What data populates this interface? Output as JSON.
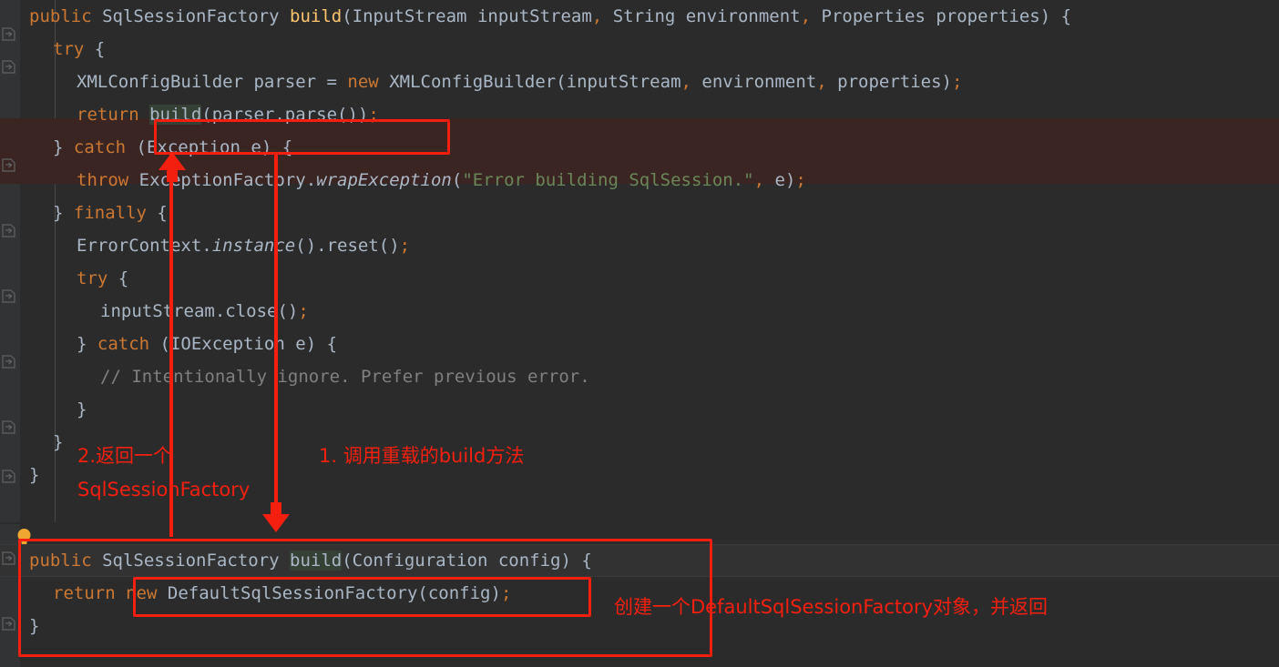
{
  "theme": {
    "background": "#2b2b2b",
    "gutter": "#313335",
    "error_line_background": "#3a2523",
    "current_line_background": "#323232",
    "annotation_color": "#f41f0f",
    "keyword": "#cc7832",
    "method": "#ffc66d",
    "string": "#6a8759",
    "comment": "#808080",
    "text": "#a9b7c6",
    "selection": "#344134"
  },
  "editor_top": {
    "name": "sql-session-factory-builder-build-inputstream",
    "lines": [
      {
        "indent": 0,
        "tokens": [
          {
            "t": "public",
            "c": "kw"
          },
          {
            "t": " ",
            "c": "pun"
          },
          {
            "t": "SqlSessionFactory",
            "c": "typ"
          },
          {
            "t": " ",
            "c": "pun"
          },
          {
            "t": "build",
            "c": "fn"
          },
          {
            "t": "(",
            "c": "pun"
          },
          {
            "t": "InputStream",
            "c": "typ"
          },
          {
            "t": " inputStream",
            "c": "ident"
          },
          {
            "t": ",",
            "c": "semi"
          },
          {
            "t": " ",
            "c": "pun"
          },
          {
            "t": "String",
            "c": "typ"
          },
          {
            "t": " environment",
            "c": "ident"
          },
          {
            "t": ",",
            "c": "semi"
          },
          {
            "t": " ",
            "c": "pun"
          },
          {
            "t": "Properties",
            "c": "typ"
          },
          {
            "t": " properties",
            "c": "ident"
          },
          {
            "t": ") {",
            "c": "pun"
          }
        ]
      },
      {
        "indent": 1,
        "tokens": [
          {
            "t": "try",
            "c": "kw"
          },
          {
            "t": " {",
            "c": "pun"
          }
        ]
      },
      {
        "indent": 2,
        "tokens": [
          {
            "t": "XMLConfigBuilder",
            "c": "typ"
          },
          {
            "t": " parser = ",
            "c": "ident"
          },
          {
            "t": "new",
            "c": "kw"
          },
          {
            "t": " ",
            "c": "pun"
          },
          {
            "t": "XMLConfigBuilder",
            "c": "typ"
          },
          {
            "t": "(inputStream",
            "c": "ident"
          },
          {
            "t": ",",
            "c": "semi"
          },
          {
            "t": " environment",
            "c": "ident"
          },
          {
            "t": ",",
            "c": "semi"
          },
          {
            "t": " properties",
            "c": "ident"
          },
          {
            "t": ")",
            "c": "pun"
          },
          {
            "t": ";",
            "c": "semi"
          }
        ]
      },
      {
        "indent": 2,
        "tokens": [
          {
            "t": "return",
            "c": "kw"
          },
          {
            "t": " ",
            "c": "pun"
          },
          {
            "t": "build",
            "c": "sel"
          },
          {
            "t": "(parser.parse())",
            "c": "ident"
          },
          {
            "t": ";",
            "c": "semi"
          }
        ]
      },
      {
        "indent": 1,
        "tokens": [
          {
            "t": "} ",
            "c": "pun"
          },
          {
            "t": "catch",
            "c": "kw"
          },
          {
            "t": " (",
            "c": "pun"
          },
          {
            "t": "Exception",
            "c": "typ"
          },
          {
            "t": " e) {",
            "c": "ident"
          }
        ]
      },
      {
        "indent": 2,
        "tokens": [
          {
            "t": "throw",
            "c": "kw"
          },
          {
            "t": " ",
            "c": "pun"
          },
          {
            "t": "ExceptionFactory",
            "c": "typ"
          },
          {
            "t": ".",
            "c": "pun"
          },
          {
            "t": "wrapException",
            "c": "ital"
          },
          {
            "t": "(",
            "c": "pun"
          },
          {
            "t": "\"Error building SqlSession.\"",
            "c": "str"
          },
          {
            "t": ",",
            "c": "semi"
          },
          {
            "t": " e)",
            "c": "ident"
          },
          {
            "t": ";",
            "c": "semi"
          }
        ]
      },
      {
        "indent": 1,
        "tokens": [
          {
            "t": "} ",
            "c": "pun"
          },
          {
            "t": "finally",
            "c": "kw"
          },
          {
            "t": " {",
            "c": "pun"
          }
        ]
      },
      {
        "indent": 2,
        "tokens": [
          {
            "t": "ErrorContext",
            "c": "typ"
          },
          {
            "t": ".",
            "c": "pun"
          },
          {
            "t": "instance",
            "c": "ital"
          },
          {
            "t": "().reset()",
            "c": "ident"
          },
          {
            "t": ";",
            "c": "semi"
          }
        ]
      },
      {
        "indent": 2,
        "tokens": [
          {
            "t": "try",
            "c": "kw"
          },
          {
            "t": " {",
            "c": "pun"
          }
        ]
      },
      {
        "indent": 3,
        "tokens": [
          {
            "t": "inputStream.close()",
            "c": "ident"
          },
          {
            "t": ";",
            "c": "semi"
          }
        ]
      },
      {
        "indent": 2,
        "tokens": [
          {
            "t": "} ",
            "c": "pun"
          },
          {
            "t": "catch",
            "c": "kw"
          },
          {
            "t": " (",
            "c": "pun"
          },
          {
            "t": "IOException",
            "c": "typ"
          },
          {
            "t": " e) {",
            "c": "ident"
          }
        ]
      },
      {
        "indent": 3,
        "tokens": [
          {
            "t": "// Intentionally ignore. Prefer previous error.",
            "c": "cmt"
          }
        ]
      },
      {
        "indent": 2,
        "tokens": [
          {
            "t": "}",
            "c": "pun"
          }
        ]
      },
      {
        "indent": 1,
        "tokens": [
          {
            "t": "}",
            "c": "pun"
          }
        ]
      },
      {
        "indent": 0,
        "tokens": [
          {
            "t": "}",
            "c": "pun"
          }
        ]
      }
    ]
  },
  "editor_bottom": {
    "name": "sql-session-factory-builder-build-configuration",
    "lines": [
      {
        "indent": 0,
        "tokens": [
          {
            "t": "public",
            "c": "kw"
          },
          {
            "t": " ",
            "c": "pun"
          },
          {
            "t": "SqlSessionFactory",
            "c": "typ"
          },
          {
            "t": " ",
            "c": "pun"
          },
          {
            "t": "build",
            "c": "sel"
          },
          {
            "t": "(",
            "c": "pun"
          },
          {
            "t": "Configuration",
            "c": "typ"
          },
          {
            "t": " config",
            "c": "ident"
          },
          {
            "t": ") {",
            "c": "pun"
          }
        ]
      },
      {
        "indent": 1,
        "tokens": [
          {
            "t": "return",
            "c": "kw"
          },
          {
            "t": " ",
            "c": "pun"
          },
          {
            "t": "new",
            "c": "kw"
          },
          {
            "t": " ",
            "c": "pun"
          },
          {
            "t": "DefaultSqlSessionFactory",
            "c": "typ"
          },
          {
            "t": "(config)",
            "c": "ident"
          },
          {
            "t": ";",
            "c": "semi"
          }
        ]
      },
      {
        "indent": 0,
        "tokens": [
          {
            "t": "}",
            "c": "pun"
          }
        ]
      }
    ]
  },
  "annotations": {
    "step1_label": "1. 调用重载的build方法",
    "step2_label_line1": "2.返回一个",
    "step2_label_line2": "SqlSessionFactory",
    "step3_label": "创建一个DefaultSqlSessionFactory对象，并返回",
    "boxes": [
      {
        "name": "build-call-box"
      },
      {
        "name": "new-default-factory-box"
      },
      {
        "name": "bottom-method-box"
      }
    ]
  },
  "gutter": {
    "fold_icon": "fold-arrow-icon",
    "bulb_icon": "intention-bulb-icon"
  }
}
